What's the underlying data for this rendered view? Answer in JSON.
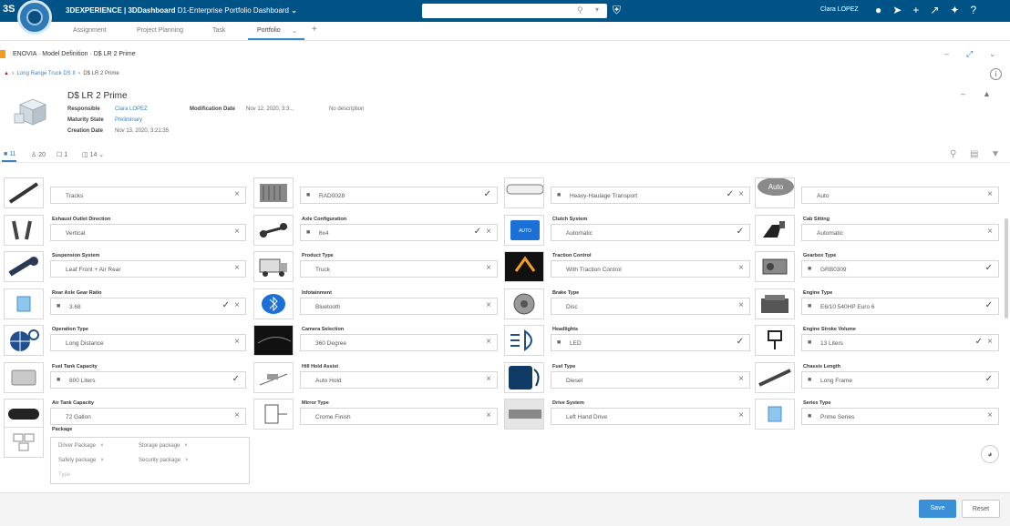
{
  "topbar": {
    "brand": "3S",
    "title_bold": "3DEXPERIENCE | 3DDashboard",
    "title_rest": " D1-Enterprise Portfolio Dashboard",
    "user": "Clara LOPEZ"
  },
  "tabs": [
    "Assignment",
    "Project Planning",
    "Task",
    "Portfolio"
  ],
  "titlebar": {
    "title": "ENOVIA · Model Definition · D$ LR 2 Prime"
  },
  "breadcrumb": {
    "root": "Long Range Truck DS II",
    "current": "D$ LR 2 Prime"
  },
  "product": {
    "title": "D$ LR 2 Prime",
    "meta": [
      {
        "k": "Responsible",
        "v": "Clara LOPEZ"
      },
      {
        "k": "Maturity State",
        "v": "Preliminary"
      },
      {
        "k": "Creation Date",
        "v": "Nov 13, 2020, 3:21:35"
      },
      {
        "k": "Modification Date",
        "v": "Nov 12, 2020, 3:3..."
      },
      {
        "k": "",
        "v": "No description"
      }
    ]
  },
  "counts": [
    "11",
    "20",
    "1",
    "14"
  ],
  "fields": [
    {
      "label": "",
      "value": "Tracks",
      "lock": false,
      "check": false,
      "x": true,
      "thumb": "track-thumb"
    },
    {
      "label": "Exhaust Outlet Direction",
      "value": "Vertical",
      "lock": false,
      "check": false,
      "x": true,
      "thumb": "exhaust-thumb"
    },
    {
      "label": "Suspension System",
      "value": "Leaf Front + Air Rear",
      "lock": false,
      "check": false,
      "x": true,
      "thumb": "suspension-thumb"
    },
    {
      "label": "Rear Axle Gear Ratio",
      "value": "3.68",
      "lock": true,
      "check": true,
      "x": true,
      "thumb": "gear-ratio-thumb"
    },
    {
      "label": "Operation Type",
      "value": "Long Distance",
      "lock": false,
      "check": false,
      "x": true,
      "thumb": "operation-thumb"
    },
    {
      "label": "Fuel Tank Capacity",
      "value": "800 Liters",
      "lock": true,
      "check": true,
      "x": false,
      "thumb": "fuel-tank-thumb"
    },
    {
      "label": "Air Tank Capacity",
      "value": "72 Gallon",
      "lock": false,
      "check": false,
      "x": true,
      "thumb": "air-tank-thumb"
    },
    {
      "label": "",
      "value": "RAD0028",
      "lock": true,
      "check": true,
      "x": false,
      "thumb": "radiator-thumb"
    },
    {
      "label": "Axle Configuration",
      "value": "6x4",
      "lock": true,
      "check": true,
      "x": true,
      "thumb": "axle-thumb"
    },
    {
      "label": "Product Type",
      "value": "Truck",
      "lock": false,
      "check": false,
      "x": true,
      "thumb": "truck-thumb"
    },
    {
      "label": "Infotainment",
      "value": "Bluetooth",
      "lock": false,
      "check": false,
      "x": true,
      "thumb": "bluetooth-thumb"
    },
    {
      "label": "Camera Selection",
      "value": "360 Degree",
      "lock": false,
      "check": false,
      "x": true,
      "thumb": "camera-thumb"
    },
    {
      "label": "Hill Hold Assist",
      "value": "Auto Hold",
      "lock": false,
      "check": false,
      "x": true,
      "thumb": "hill-hold-thumb"
    },
    {
      "label": "Mirror Type",
      "value": "Crome Finish",
      "lock": false,
      "check": false,
      "x": true,
      "thumb": "mirror-thumb"
    },
    {
      "label": "",
      "value": "Heavy-Haulage Transport",
      "lock": true,
      "check": true,
      "x": true,
      "thumb": "trailer-thumb"
    },
    {
      "label": "Clutch System",
      "value": "Automatic",
      "lock": false,
      "check": true,
      "x": false,
      "thumb": "clutch-thumb"
    },
    {
      "label": "Traction Control",
      "value": "With Traction Control",
      "lock": false,
      "check": false,
      "x": true,
      "thumb": "traction-thumb"
    },
    {
      "label": "Brake Type",
      "value": "Disc",
      "lock": false,
      "check": false,
      "x": true,
      "thumb": "brake-thumb"
    },
    {
      "label": "Headlights",
      "value": "LED",
      "lock": true,
      "check": true,
      "x": false,
      "thumb": "headlight-thumb"
    },
    {
      "label": "Fuel Type",
      "value": "Diesel",
      "lock": false,
      "check": false,
      "x": true,
      "thumb": "fuel-type-thumb"
    },
    {
      "label": "Drive System",
      "value": "Left Hand Drive",
      "lock": false,
      "check": false,
      "x": true,
      "thumb": "drive-thumb"
    },
    {
      "label": "",
      "value": "Auto",
      "lock": false,
      "check": false,
      "x": true,
      "thumb": "auto-thumb"
    },
    {
      "label": "Cab Sitting",
      "value": "Automatic",
      "lock": false,
      "check": false,
      "x": true,
      "thumb": "cab-thumb"
    },
    {
      "label": "Gearbox Type",
      "value": "GRB0309",
      "lock": true,
      "check": true,
      "x": false,
      "thumb": "gearbox-thumb"
    },
    {
      "label": "Engine Type",
      "value": "E6/10 540HP Euro 6",
      "lock": true,
      "check": true,
      "x": false,
      "thumb": "engine-thumb"
    },
    {
      "label": "Engine Stroke Volume",
      "value": "13 Liters",
      "lock": true,
      "check": true,
      "x": true,
      "thumb": "piston-thumb"
    },
    {
      "label": "Chassis Length",
      "value": "Long Frame",
      "lock": true,
      "check": true,
      "x": false,
      "thumb": "chassis-thumb"
    },
    {
      "label": "Series Type",
      "value": "Prime Series",
      "lock": true,
      "check": false,
      "x": true,
      "thumb": "series-thumb"
    }
  ],
  "package": {
    "label": "Package",
    "chips": [
      "Driver Package",
      "Storage package",
      "Safety package",
      "Security package"
    ],
    "input_placeholder": "Type"
  },
  "footer": {
    "save": "Save",
    "reset": "Reset"
  },
  "colors": {
    "topbar": "#005386",
    "accent": "#3a8fd6",
    "orange": "#f29b1e"
  }
}
